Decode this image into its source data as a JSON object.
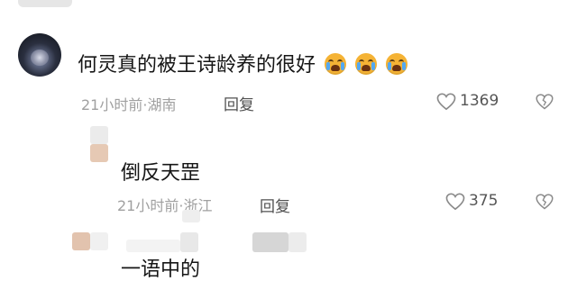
{
  "comments": [
    {
      "text": "何灵真的被王诗龄养的很好",
      "emojis": [
        "crying-face",
        "crying-face",
        "crying-face"
      ],
      "time_location": "21小时前·湖南",
      "reply_label": "回复",
      "likes": "1369"
    },
    {
      "text": "倒反天罡",
      "time_location": "21小时前·浙江",
      "reply_label": "回复",
      "likes": "375"
    },
    {
      "text": "一语中的"
    }
  ],
  "colors": {
    "text": "#161616",
    "meta": "#a0a0a0",
    "reply": "#505050",
    "icon": "#8a8a8a"
  },
  "icons": {
    "like": "heart-outline",
    "dislike": "broken-heart-outline"
  }
}
